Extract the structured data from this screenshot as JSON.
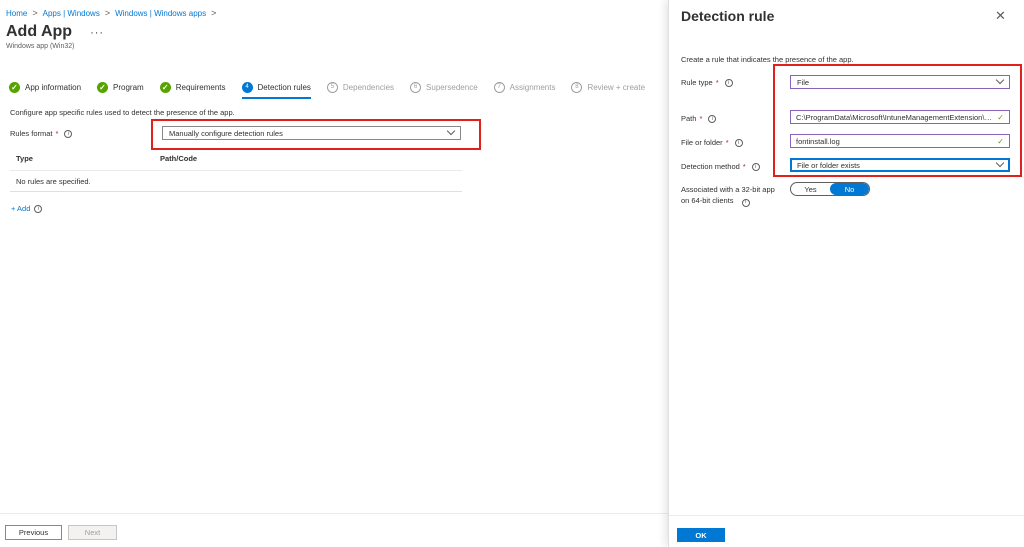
{
  "breadcrumb": {
    "items": [
      "Home",
      "Apps | Windows",
      "Windows | Windows apps"
    ],
    "separator": ">"
  },
  "page": {
    "title": "Add App",
    "more": "···",
    "subtitle": "Windows app (Win32)"
  },
  "steps": [
    {
      "label": "App information",
      "state": "done",
      "marker": "✓"
    },
    {
      "label": "Program",
      "state": "done",
      "marker": "✓"
    },
    {
      "label": "Requirements",
      "state": "done",
      "marker": "✓"
    },
    {
      "label": "Detection rules",
      "state": "active",
      "marker": "4"
    },
    {
      "label": "Dependencies",
      "state": "pending",
      "marker": "5"
    },
    {
      "label": "Supersedence",
      "state": "pending",
      "marker": "6"
    },
    {
      "label": "Assignments",
      "state": "pending",
      "marker": "7"
    },
    {
      "label": "Review + create",
      "state": "pending",
      "marker": "8"
    }
  ],
  "detection": {
    "description": "Configure app specific rules used to detect the presence of the app.",
    "rules_format_label": "Rules format",
    "required_marker": "*",
    "info_marker": "i",
    "rules_format_value": "Manually configure detection rules",
    "table": {
      "columns": [
        "Type",
        "Path/Code"
      ],
      "empty_text": "No rules are specified."
    },
    "add_label": "+ Add"
  },
  "footer": {
    "previous": "Previous",
    "next": "Next"
  },
  "panel": {
    "title": "Detection rule",
    "close": "✕",
    "description": "Create a rule that indicates the presence of the app.",
    "rule_type": {
      "label": "Rule type",
      "value": "File"
    },
    "path": {
      "label": "Path",
      "value": "C:\\ProgramData\\Microsoft\\IntuneManagementExtension\\Logs"
    },
    "file_or_folder": {
      "label": "File or folder",
      "value": "fontinstall.log"
    },
    "detection_method": {
      "label": "Detection method",
      "value": "File or folder exists"
    },
    "assoc_32bit": {
      "label": "Associated with a 32-bit app on 64-bit clients",
      "options": [
        "Yes",
        "No"
      ],
      "selected": "No"
    },
    "ok": "OK"
  },
  "colors": {
    "accent": "#0078d4",
    "success": "#57a300",
    "highlight": "#e0201b",
    "required": "#a4262c"
  }
}
